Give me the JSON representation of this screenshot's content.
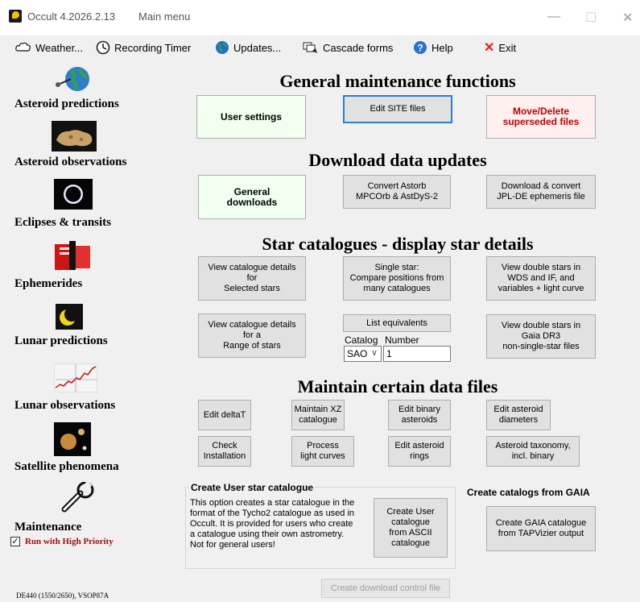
{
  "window": {
    "title": "Occult 4.2026.2.13",
    "mode": "Main menu",
    "minimize": "—",
    "maximize": "☐",
    "close": "✕"
  },
  "menu": {
    "weather": "Weather...",
    "recording_timer": "Recording Timer",
    "updates": "Updates...",
    "cascade_forms": "Cascade forms",
    "help": "Help",
    "exit": "Exit"
  },
  "sidebar": {
    "asteroid_predictions": "Asteroid predictions",
    "asteroid_observations": "Asteroid observations",
    "eclipses_transits": "Eclipses & transits",
    "ephemerides": "Ephemerides",
    "lunar_predictions": "Lunar predictions",
    "lunar_observations": "Lunar observations",
    "satellite_phenomena": "Satellite phenomena",
    "maintenance": "Maintenance",
    "run_high_priority": "Run with High Priority",
    "run_high_priority_checked": true
  },
  "status": {
    "ephemeris": "DE440 (1550/2650), VSOP87A"
  },
  "general_maintenance": {
    "heading": "General maintenance functions",
    "user_settings": "User settings",
    "edit_site_files": "Edit SITE files",
    "move_delete": "Move/Delete\nsuperseded files"
  },
  "download_updates": {
    "heading": "Download data updates",
    "general_downloads": "General\ndownloads",
    "convert_astorb": "Convert Astorb\nMPCOrb & AstDyS-2",
    "download_jpl": "Download & convert\nJPL-DE ephemeris  file"
  },
  "star_catalogues": {
    "heading": "Star catalogues - display star details",
    "view_selected": "View catalogue details\nfor\nSelected stars",
    "single_star": "Single star:\nCompare positions from\nmany catalogues",
    "view_double_wds": "View double stars in\nWDS and IF, and\nvariables + light curve",
    "view_range": "View catalogue details\nfor a\nRange of stars",
    "list_equivalents": "List equivalents",
    "catalog_label": "Catalog",
    "number_label": "Number",
    "catalog_value": "SAO",
    "number_value": "1",
    "view_double_gaia": "View double stars in\nGaia DR3\nnon-single-star files"
  },
  "maintain_data": {
    "heading": "Maintain certain data files",
    "edit_deltat": "Edit deltaT",
    "maintain_xz": "Maintain XZ\ncatalogue",
    "edit_binary": "Edit binary\nasteroids",
    "edit_diameters": "Edit asteroid\ndiameters",
    "check_installation": "Check\nInstallation",
    "process_light_curves": "Process\nlight curves",
    "edit_rings": "Edit asteroid\nrings",
    "taxonomy": "Asteroid taxonomy,\nincl. binary"
  },
  "user_catalogue": {
    "title": "Create User star catalogue",
    "description": "This option creates a star catalogue in the\nformat of the Tycho2 catalogue as used in\nOccult. It is provided for users who create\na catalogue using their own astrometry.\nNot for general users!",
    "button": "Create User\ncatalogue\nfrom ASCII\ncatalogue"
  },
  "gaia": {
    "title": "Create catalogs from GAIA",
    "button": "Create GAIA catalogue\nfrom TAPVizier output"
  },
  "footer": {
    "create_download_control": "Create download control file"
  }
}
